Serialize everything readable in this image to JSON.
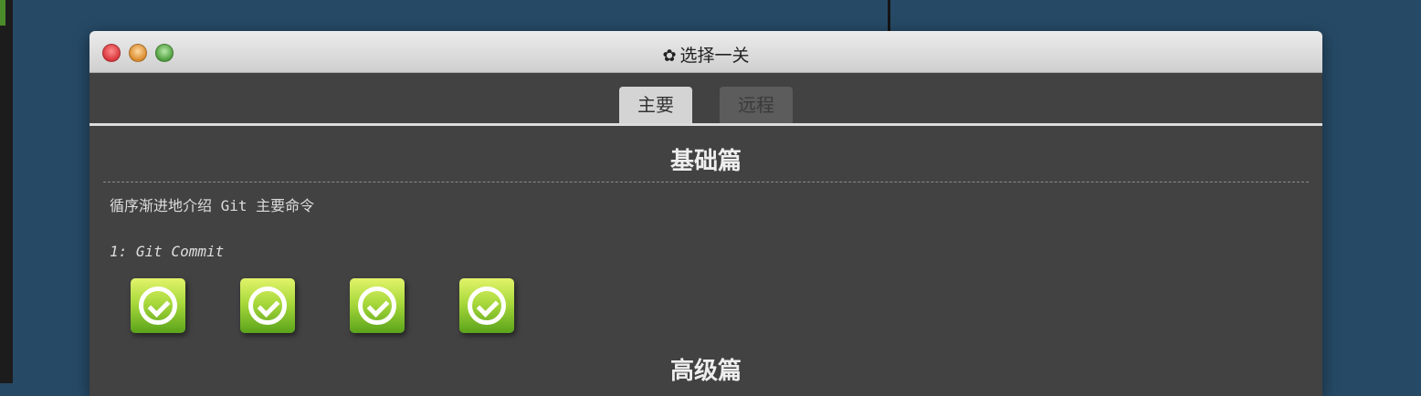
{
  "window": {
    "title": "选择一关",
    "title_icon": "gear-icon"
  },
  "tabs": [
    {
      "label": "主要",
      "active": true
    },
    {
      "label": "远程",
      "active": false
    }
  ],
  "sections": [
    {
      "title": "基础篇",
      "description": "循序渐进地介绍 Git 主要命令",
      "levels": [
        {
          "name": "1: Git Commit",
          "buttons": [
            {
              "status": "completed",
              "icon": "check-icon"
            },
            {
              "status": "completed",
              "icon": "check-icon"
            },
            {
              "status": "completed",
              "icon": "check-icon"
            },
            {
              "status": "completed",
              "icon": "check-icon"
            }
          ]
        }
      ]
    },
    {
      "title": "高级篇"
    }
  ],
  "colors": {
    "desktop": "#264a66",
    "window_body": "#424242",
    "level_button_green": "#5aa31b"
  }
}
